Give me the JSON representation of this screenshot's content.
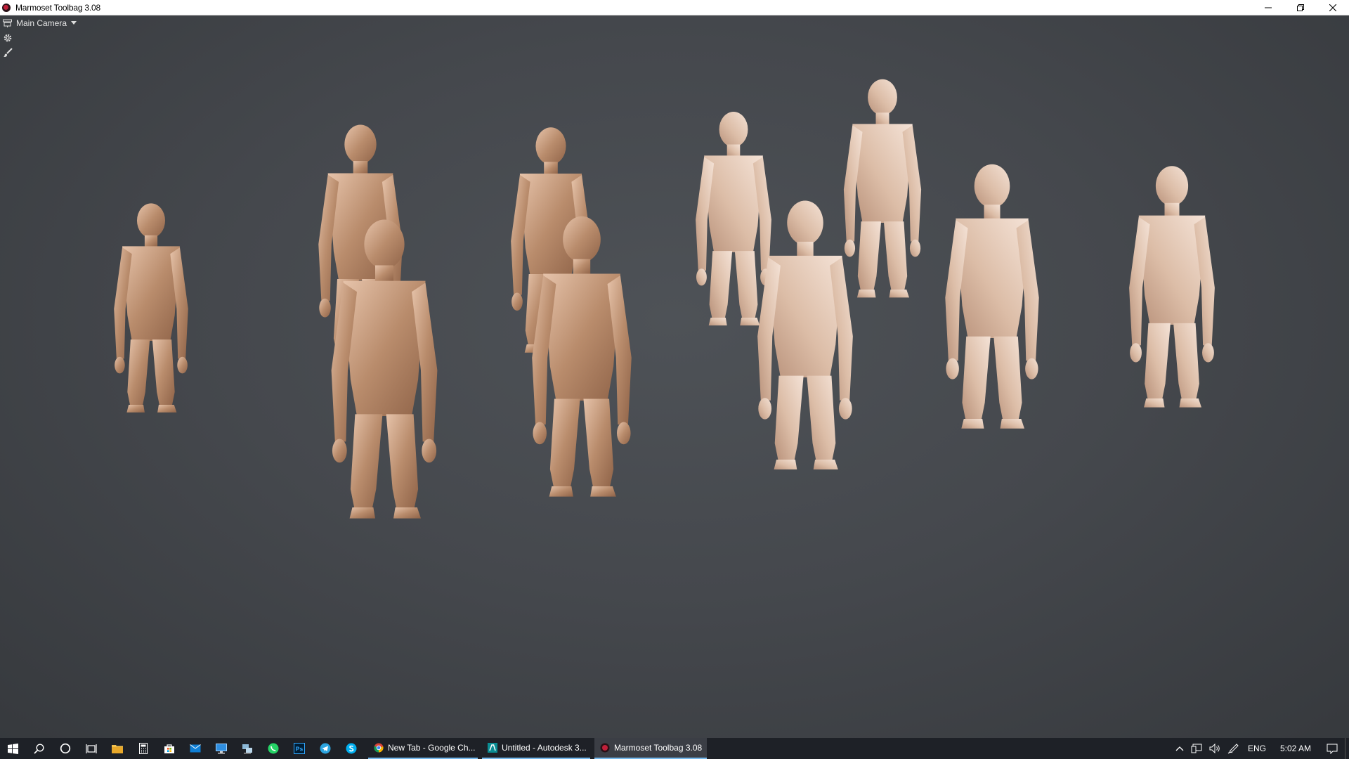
{
  "window": {
    "title": "Marmoset Toolbag 3.08",
    "app_icon": "marmoset-icon",
    "controls": [
      "minimize-icon",
      "restore-icon",
      "close-icon"
    ]
  },
  "viewport": {
    "camera_menu_label": "Main Camera",
    "tools": [
      "settings-icon",
      "paint-brush-icon"
    ],
    "scene": "ten low-poly human figures standing on a grey background"
  },
  "taskbar": {
    "pinned": [
      "start-icon",
      "search-icon",
      "cortana-icon",
      "task-view-icon",
      "file-explorer-icon",
      "calculator-icon",
      "store-icon",
      "mail-icon",
      "remote-desktop-icon",
      "network-icon",
      "whatsapp-icon",
      "photoshop-icon",
      "telegram-icon",
      "skype-icon"
    ],
    "photoshop_label": "Ps",
    "tasks": [
      {
        "label": "New Tab - Google Ch...",
        "icon": "chrome-icon"
      },
      {
        "label": "Untitled - Autodesk 3...",
        "icon": "3dsmax-icon"
      },
      {
        "label": "Marmoset Toolbag 3.08",
        "icon": "marmoset-icon"
      }
    ],
    "tray": {
      "language": "ENG",
      "time": "5:02 AM",
      "icons": [
        "chevron-up-icon",
        "network-status-icon",
        "volume-icon",
        "pen-icon",
        "notifications-icon"
      ]
    }
  },
  "colors": {
    "viewport_bg": "#45484d",
    "figure_skin": "#c9a084",
    "taskbar_bg": "#1e2127",
    "active_task_underline": "#76b9ed"
  }
}
